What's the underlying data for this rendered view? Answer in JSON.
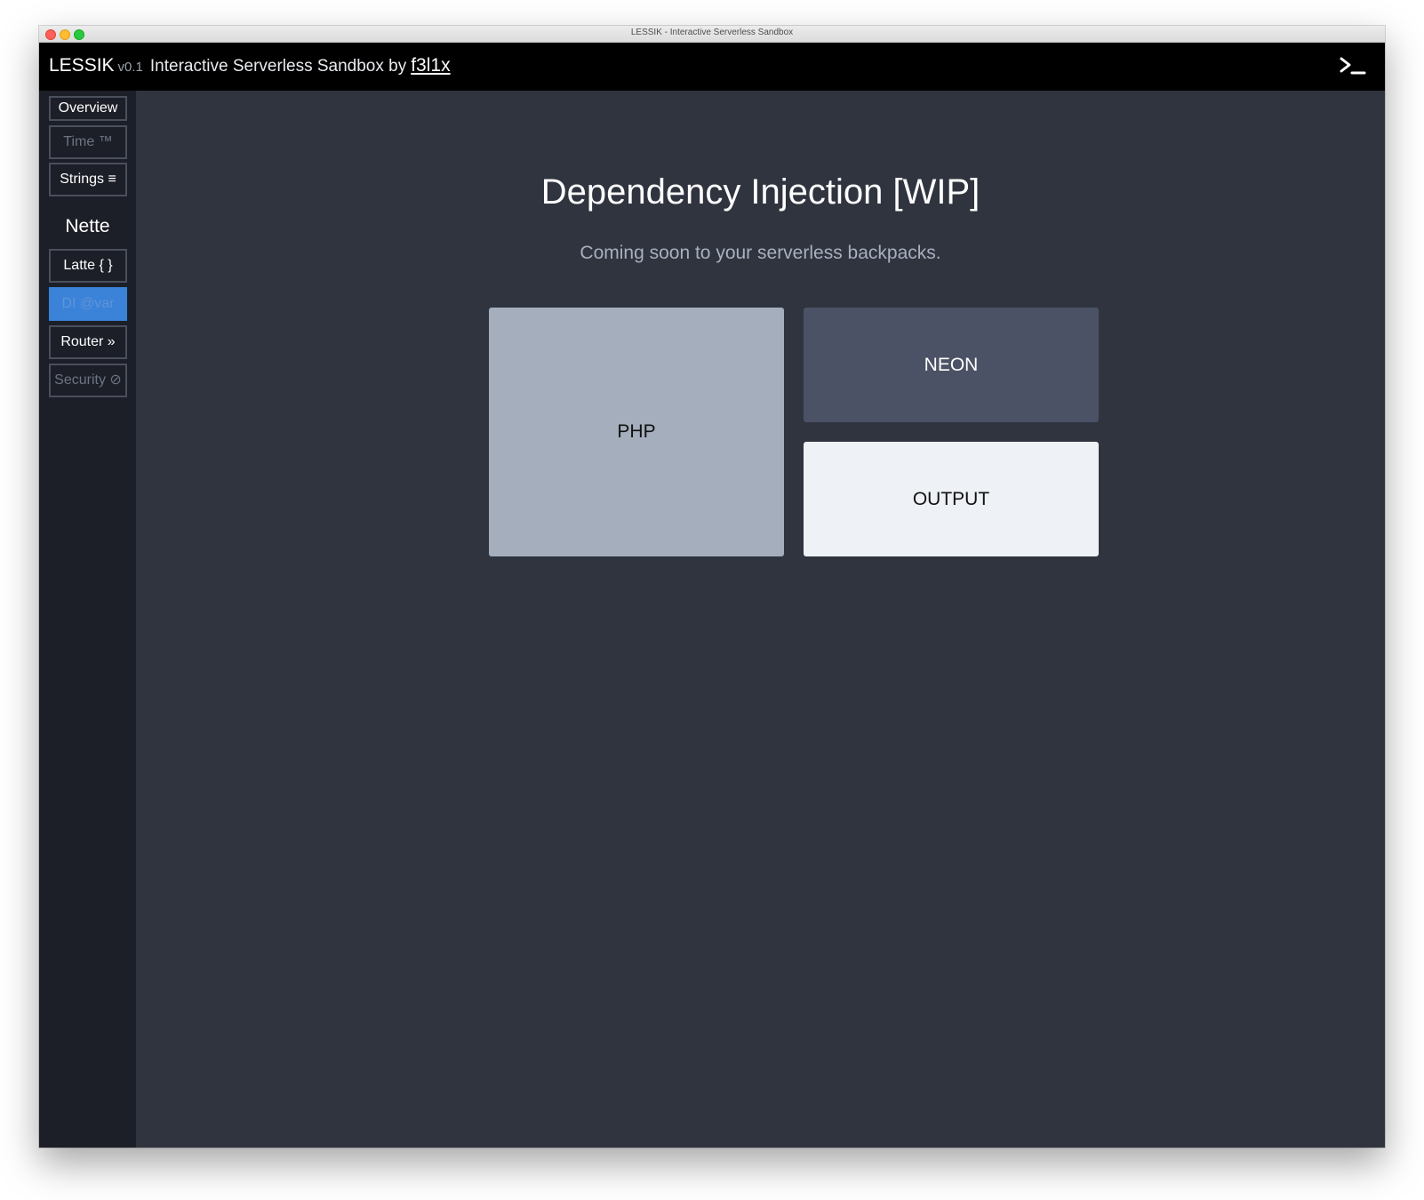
{
  "window": {
    "title": "LESSIK - Interactive Serverless Sandbox"
  },
  "header": {
    "brand": "LESSIK",
    "version": "v0.1",
    "tagline": "Interactive Serverless Sandbox by",
    "author": "f3l1x",
    "terminal_icon": "terminal-prompt-icon"
  },
  "sidebar": {
    "items": [
      {
        "label": "Overview",
        "state": "normal"
      },
      {
        "label": "Time ™",
        "state": "disabled"
      },
      {
        "label": "Strings ≡",
        "state": "normal"
      }
    ],
    "section_heading": "Nette",
    "section_items": [
      {
        "label": "Latte { }",
        "state": "normal"
      },
      {
        "label": "DI @var",
        "state": "active"
      },
      {
        "label": "Router »",
        "state": "normal"
      },
      {
        "label": "Security ⊘",
        "state": "disabled"
      }
    ]
  },
  "main": {
    "title": "Dependency Injection [WIP]",
    "subtitle": "Coming soon to your serverless backpacks.",
    "panels": {
      "php": "PHP",
      "neon": "NEON",
      "output": "OUTPUT"
    }
  },
  "colors": {
    "header_bg": "#000000",
    "sidebar_bg": "#1c1f28",
    "main_bg": "#30343f",
    "accent": "#3b82d9",
    "php_panel": "#a4aebc",
    "neon_panel": "#4b5265",
    "output_panel": "#eef1f5"
  }
}
